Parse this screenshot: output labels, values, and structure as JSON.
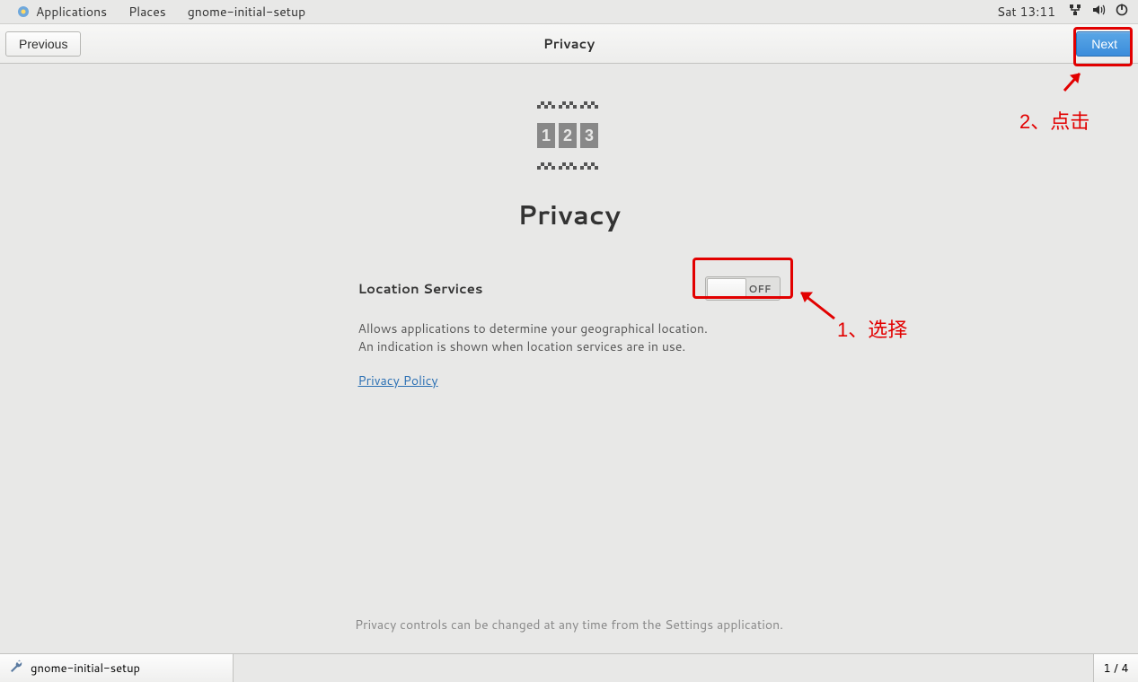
{
  "top_panel": {
    "applications": "Applications",
    "places": "Places",
    "app_name": "gnome-initial-setup",
    "clock": "Sat 13:11"
  },
  "header": {
    "previous": "Previous",
    "title": "Privacy",
    "next": "Next"
  },
  "page": {
    "heading": "Privacy",
    "setting_label": "Location Services",
    "toggle_state": "OFF",
    "description": "Allows applications to determine your geographical location. An indication is shown when location services are in use.",
    "policy_link": "Privacy Policy",
    "footnote": "Privacy controls can be changed at any time from the Settings application."
  },
  "taskbar": {
    "task_label": "gnome-initial-setup",
    "workspace": "1 / 4"
  },
  "annotations": {
    "step1": "1、选择",
    "step2": "2、点击"
  }
}
